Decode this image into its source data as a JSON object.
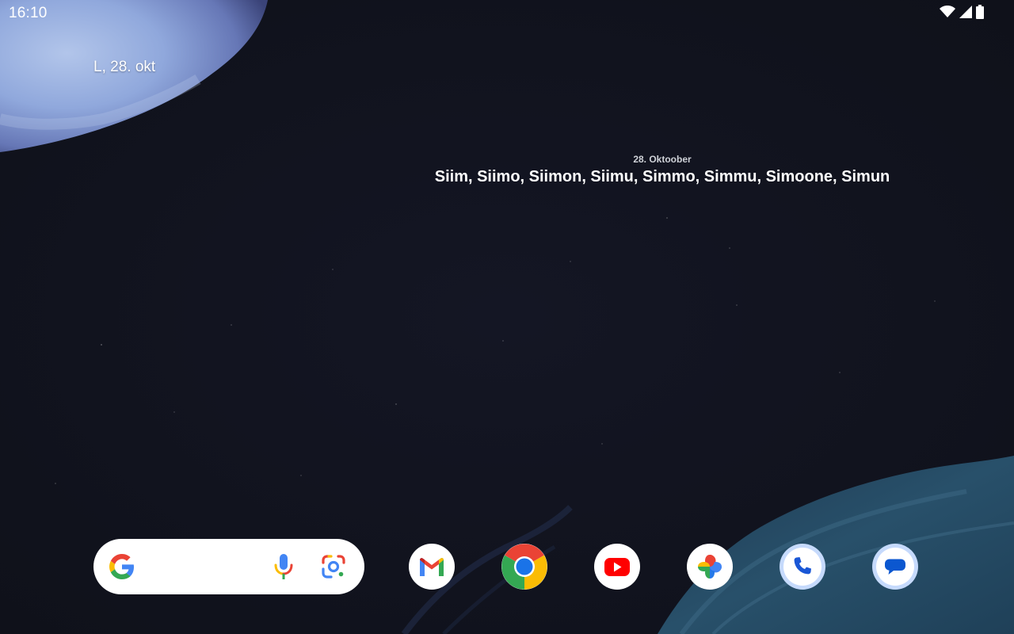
{
  "status_bar": {
    "time": "16:10"
  },
  "home": {
    "glance_date": "L, 28. okt"
  },
  "nameday_widget": {
    "date": "28. Oktoober",
    "names": "Siim, Siimo, Siimon, Siimu, Simmo, Simmu, Simoone, Simun"
  },
  "search_bar": {
    "icons": [
      "google-g-icon",
      "microphone-icon",
      "google-lens-icon"
    ]
  },
  "dock": {
    "apps": [
      "gmail-icon",
      "chrome-icon",
      "youtube-icon",
      "google-photos-icon",
      "phone-icon",
      "messages-icon"
    ]
  },
  "colors": {
    "background": "#12131d",
    "google_blue": "#4285f4",
    "google_red": "#ea4335",
    "google_yellow": "#fbbc04",
    "google_green": "#34a853",
    "dock_badge_blue": "#c6dafc"
  }
}
